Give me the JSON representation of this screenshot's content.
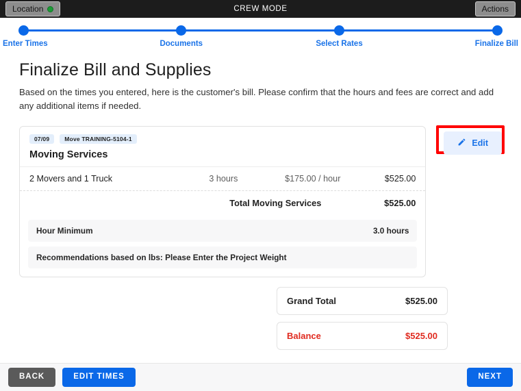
{
  "titlebar": {
    "location_label": "Location",
    "status_dot": "green-status-dot",
    "app_title": "CREW MODE",
    "actions_label": "Actions"
  },
  "stepper": {
    "steps": [
      {
        "label": "Enter Times"
      },
      {
        "label": "Documents"
      },
      {
        "label": "Select Rates"
      },
      {
        "label": "Finalize Bill"
      }
    ]
  },
  "page": {
    "title": "Finalize Bill and Supplies",
    "description": "Based on the times you entered, here is the customer's bill. Please confirm that the hours and fees are correct and add any additional items if needed."
  },
  "bill": {
    "badges": {
      "date": "07/09",
      "move": "Move TRAINING-5104-1"
    },
    "section_title": "Moving Services",
    "line_items": [
      {
        "name": "2 Movers and 1 Truck",
        "quantity": "3 hours",
        "rate": "$175.00 / hour",
        "amount": "$525.00"
      }
    ],
    "section_total": {
      "label": "Total Moving Services",
      "amount": "$525.00"
    },
    "notes": [
      {
        "label": "Hour Minimum",
        "value": "3.0 hours"
      },
      {
        "label": "Recommendations based on lbs: Please Enter the Project Weight",
        "value": ""
      }
    ],
    "edit_label": "Edit",
    "edit_icon": "pencil-icon"
  },
  "totals": [
    {
      "label": "Grand Total",
      "amount": "$525.00",
      "style": "normal"
    },
    {
      "label": "Balance",
      "amount": "$525.00",
      "style": "danger"
    }
  ],
  "footer": {
    "back_label": "BACK",
    "edit_times_label": "EDIT TIMES",
    "next_label": "NEXT"
  },
  "colors": {
    "accent_blue": "#0a68e8",
    "link_blue": "#1a73e8",
    "badge_blue_bg": "#e3eefb",
    "danger_red": "#e02b20",
    "highlight_red": "#ff0000",
    "status_green": "#1a9c35",
    "titlebar_black": "#1c1c1c",
    "chrome_gray": "#8d8d8d",
    "back_gray": "#5a5a5a"
  }
}
